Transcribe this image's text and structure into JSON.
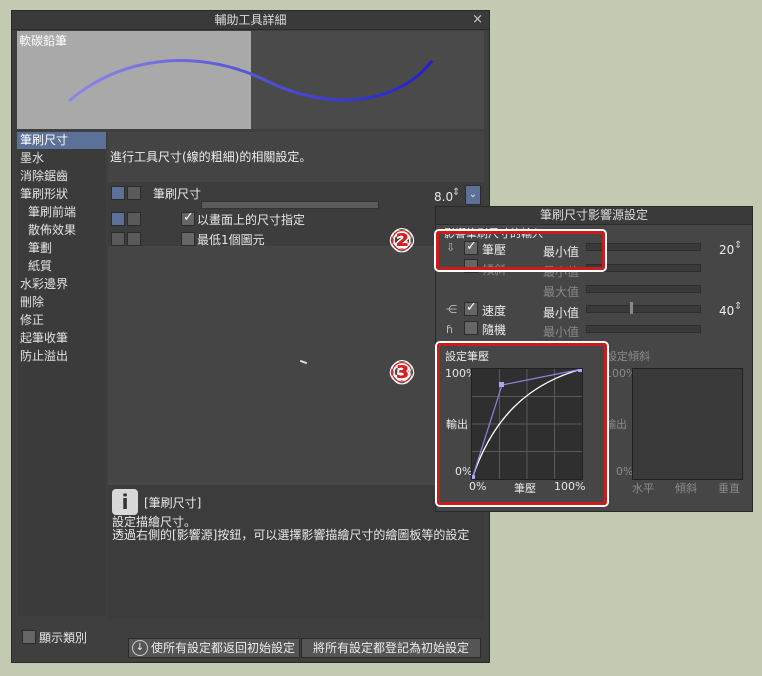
{
  "main_window": {
    "title": "輔助工具詳細",
    "close": "×",
    "preview_name": "軟碳鉛筆"
  },
  "sidebar": {
    "items": [
      {
        "label": "筆刷尺寸",
        "selected": true
      },
      {
        "label": "墨水"
      },
      {
        "label": "消除鋸齒"
      },
      {
        "label": "筆刷形狀"
      },
      {
        "label": "筆刷前端"
      },
      {
        "label": "散佈效果"
      },
      {
        "label": "筆劃"
      },
      {
        "label": "紙質"
      },
      {
        "label": "水彩邊界"
      },
      {
        "label": "刪除"
      },
      {
        "label": "修正"
      },
      {
        "label": "起筆收筆"
      },
      {
        "label": "防止溢出"
      }
    ],
    "show_category": "顯示類別"
  },
  "content": {
    "description": "進行工具尺寸(線的粗細)的相關設定。",
    "brush_size_label": "筆刷尺寸",
    "brush_size_value": "8.0",
    "option1": "以畫面上的尺寸指定",
    "option2": "最低1個圖元"
  },
  "help": {
    "title": "[筆刷尺寸]",
    "line1": "設定描繪尺寸。",
    "line2": "透過右側的[影響源]按鈕，可以選擇影響描繪尺寸的繪圖板等的設定"
  },
  "footer": {
    "reset_button": "使所有設定都返回初始設定",
    "register_button": "將所有設定都登記為初始設定"
  },
  "popup": {
    "title": "筆刷尺寸影響源設定",
    "section": "影響筆刷尺寸的輸入",
    "rows": [
      {
        "name": "筆壓",
        "checked": true,
        "label": "最小值",
        "value": "20"
      },
      {
        "name": "傾斜",
        "checked": false,
        "label": "最小值"
      },
      {
        "name": "",
        "checked": false,
        "label": "最大值"
      },
      {
        "name": "速度",
        "checked": true,
        "label": "最小值",
        "value": "40"
      },
      {
        "name": "隨機",
        "checked": false,
        "label": "最小值"
      }
    ],
    "pressure_graph": {
      "title": "設定筆壓",
      "y_top": "100%",
      "y_bottom": "0%",
      "y_axis": "輸出",
      "x_left": "0%",
      "x_axis": "筆壓",
      "x_right": "100%"
    },
    "tilt_graph": {
      "title": "設定傾斜",
      "y_top": "100%",
      "y_bottom": "0%",
      "y_axis": "輸出",
      "x_left": "水平",
      "x_mid": "傾斜",
      "x_right": "垂直"
    }
  },
  "annotations": {
    "badge_2": "②",
    "badge_3": "③"
  },
  "colors": {
    "accent": "#5b7197",
    "highlight": "#cc1b1b",
    "stroke": "#2b2bdd"
  }
}
